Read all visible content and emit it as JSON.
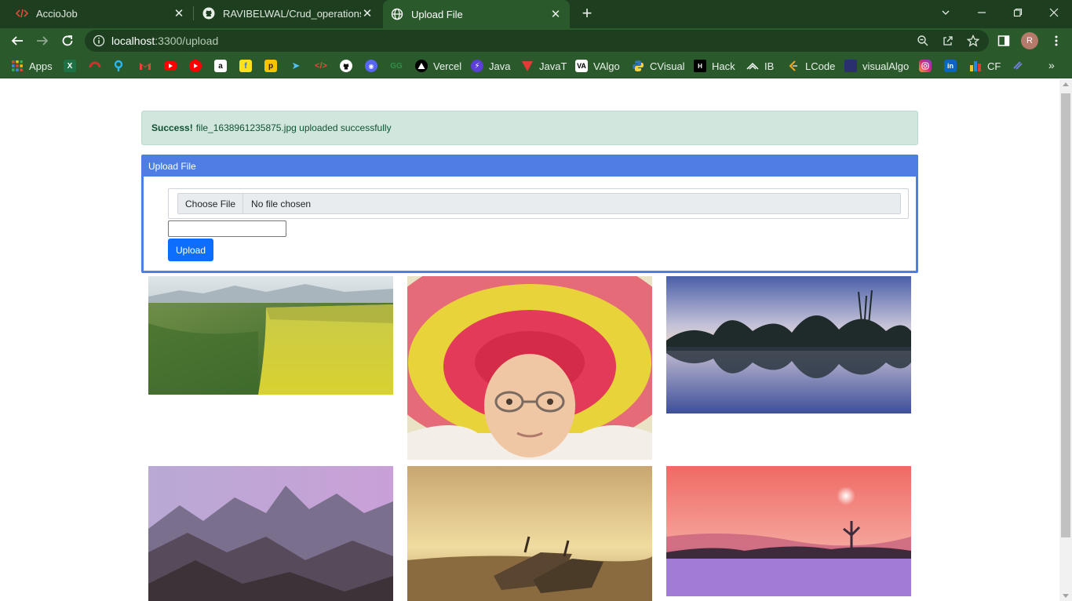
{
  "browser": {
    "tabs": [
      {
        "title": "AccioJob",
        "active": false
      },
      {
        "title": "RAVIBELWAL/Crud_operations_Ex",
        "active": false
      },
      {
        "title": "Upload File",
        "active": true
      }
    ],
    "url_host": "localhost",
    "url_rest": ":3300/upload",
    "avatar_letter": "R",
    "bookmarks": [
      {
        "label": "Apps",
        "icon": "apps-grid-icon"
      },
      {
        "label": "",
        "icon": "excel-icon"
      },
      {
        "label": "",
        "icon": "red-icon"
      },
      {
        "label": "",
        "icon": "blue-icon"
      },
      {
        "label": "",
        "icon": "gmail-icon"
      },
      {
        "label": "",
        "icon": "youtube-icon"
      },
      {
        "label": "",
        "icon": "youtube-music-icon"
      },
      {
        "label": "",
        "icon": "amazon-icon"
      },
      {
        "label": "",
        "icon": "flipkart-icon"
      },
      {
        "label": "",
        "icon": "p-icon"
      },
      {
        "label": "",
        "icon": "arrow-icon"
      },
      {
        "label": "",
        "icon": "code-icon"
      },
      {
        "label": "",
        "icon": "github-icon"
      },
      {
        "label": "",
        "icon": "discord-icon"
      },
      {
        "label": "",
        "icon": "gfg-icon"
      },
      {
        "label": "Vercel",
        "icon": "vercel-icon"
      },
      {
        "label": "Java",
        "icon": "java-icon"
      },
      {
        "label": "JavaT",
        "icon": "javat-icon"
      },
      {
        "label": "VAlgo",
        "icon": "valgo-icon"
      },
      {
        "label": "CVisual",
        "icon": "python-icon"
      },
      {
        "label": "Hack",
        "icon": "hack-icon"
      },
      {
        "label": "IB",
        "icon": "ib-icon"
      },
      {
        "label": "LCode",
        "icon": "leetcode-icon"
      },
      {
        "label": "visualAlgo",
        "icon": "visualalgo-icon"
      },
      {
        "label": "",
        "icon": "instagram-icon"
      },
      {
        "label": "",
        "icon": "linkedin-icon"
      },
      {
        "label": "CF",
        "icon": "codeforces-icon"
      },
      {
        "label": "",
        "icon": "link-icon"
      }
    ],
    "more_label": "»"
  },
  "page": {
    "alert": {
      "strong": "Success!",
      "message": "file_1638961235875.jpg uploaded successfully"
    },
    "card": {
      "header": "Upload File",
      "choose_file_label": "Choose File",
      "no_file_label": "No file chosen",
      "text_value": "",
      "upload_label": "Upload"
    },
    "gallery": [
      {
        "subject": "field"
      },
      {
        "subject": "woman-hat"
      },
      {
        "subject": "lake-trees"
      },
      {
        "subject": "mountains"
      },
      {
        "subject": "boat"
      },
      {
        "subject": "pink-sunset"
      }
    ]
  },
  "colors": {
    "chrome_dark": "#1e3f1f",
    "chrome": "#2a5a2c",
    "card_border": "#4e7ee3",
    "upload_button": "#0d6efd",
    "alert_bg": "#d1e7dd",
    "alert_text": "#0f5132"
  }
}
